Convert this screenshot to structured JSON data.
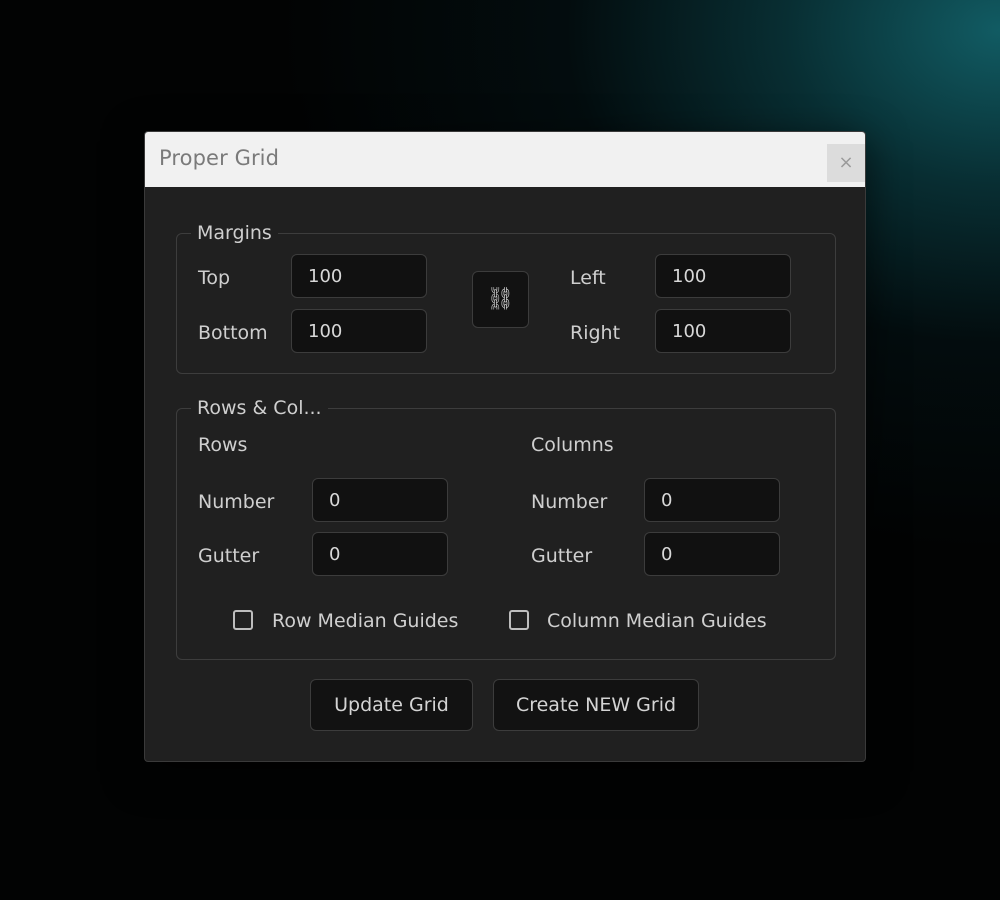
{
  "dialog": {
    "title": "Proper Grid",
    "close_glyph": "×",
    "close_icon": "close-icon"
  },
  "margins": {
    "legend": "Margins",
    "top_label": "Top",
    "top_value": "100",
    "bottom_label": "Bottom",
    "bottom_value": "100",
    "left_label": "Left",
    "left_value": "100",
    "right_label": "Right",
    "right_value": "100",
    "link_icon": "link-chain-icon",
    "link_glyph": "⛓"
  },
  "rows_cols": {
    "legend": "Rows & Col...",
    "rows": {
      "heading": "Rows",
      "number_label": "Number",
      "number_value": "0",
      "gutter_label": "Gutter",
      "gutter_value": "0"
    },
    "columns": {
      "heading": "Columns",
      "number_label": "Number",
      "number_value": "0",
      "gutter_label": "Gutter",
      "gutter_value": "0"
    },
    "row_median_label": "Row Median Guides",
    "row_median_checked": false,
    "column_median_label": "Column Median Guides",
    "column_median_checked": false
  },
  "actions": {
    "update_label": "Update Grid",
    "create_label": "Create NEW Grid"
  },
  "colors": {
    "titlebar": "#f1f1f1",
    "panel": "#202020",
    "field": "#111111",
    "text": "#cfcfcf"
  }
}
